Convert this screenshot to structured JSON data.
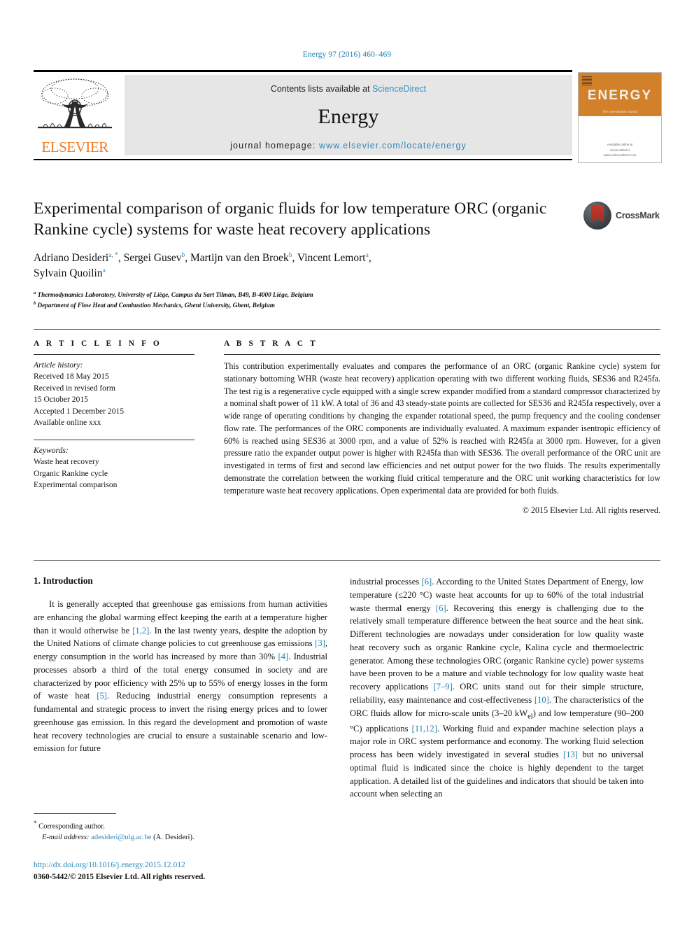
{
  "running_head": "Energy 97 (2016) 460–469",
  "banner": {
    "publisher_name": "ELSEVIER",
    "contents_prefix": "Contents lists available at ",
    "contents_link": "ScienceDirect",
    "journal_title": "Energy",
    "homepage_prefix": "journal homepage: ",
    "homepage_url": "www.elsevier.com/locate/energy",
    "cover_title": "ENERGY",
    "cover_subtitle": "The International Journal",
    "cover_footer": "Available online at\nScienceDirect\nwww.sciencedirect.com",
    "link_color": "#3a8fbf"
  },
  "article": {
    "title": "Experimental comparison of organic fluids for low temperature ORC (organic Rankine cycle) systems for waste heat recovery applications",
    "crossmark_label": "CrossMark",
    "authors_line_1_parts": [
      {
        "name": "Adriano Desideri",
        "sup": "a, *"
      },
      {
        "name": "Sergei Gusev",
        "sup": "b"
      },
      {
        "name": "Martijn van den Broek",
        "sup": "b"
      },
      {
        "name": "Vincent Lemort",
        "sup": "a"
      }
    ],
    "authors_line_2_parts": [
      {
        "name": "Sylvain Quoilin",
        "sup": "a"
      }
    ],
    "affiliations": [
      {
        "marker": "a",
        "text": "Thermodynamics Laboratory, University of Liège, Campus du Sart Tilman, B49, B-4000 Liège, Belgium"
      },
      {
        "marker": "b",
        "text": "Department of Flow Heat and Combustion Mechanics, Ghent University, Ghent, Belgium"
      }
    ]
  },
  "info": {
    "heading": "A R T I C L E  I N F O",
    "history_label": "Article history:",
    "history": [
      "Received 18 May 2015",
      "Received in revised form",
      "15 October 2015",
      "Accepted 1 December 2015",
      "Available online xxx"
    ],
    "keywords_label": "Keywords:",
    "keywords": [
      "Waste heat recovery",
      "Organic Rankine cycle",
      "Experimental comparison"
    ]
  },
  "abstract": {
    "heading": "A B S T R A C T",
    "text": "This contribution experimentally evaluates and compares the performance of an ORC (organic Rankine cycle) system for stationary bottoming WHR (waste heat recovery) application operating with two different working fluids, SES36 and R245fa. The test rig is a regenerative cycle equipped with a single screw expander modified from a standard compressor characterized by a nominal shaft power of 11 kW. A total of 36 and 43 steady-state points are collected for SES36 and R245fa respectively, over a wide range of operating conditions by changing the expander rotational speed, the pump frequency and the cooling condenser flow rate. The performances of the ORC components are individually evaluated. A maximum expander isentropic efficiency of 60% is reached using SES36 at 3000 rpm, and a value of 52% is reached with R245fa at 3000 rpm. However, for a given pressure ratio the expander output power is higher with R245fa than with SES36. The overall performance of the ORC unit are investigated in terms of first and second law efficiencies and net output power for the two fluids. The results experimentally demonstrate the correlation between the working fluid critical temperature and the ORC unit working characteristics for low temperature waste heat recovery applications. Open experimental data are provided for both fluids.",
    "copyright": "© 2015 Elsevier Ltd. All rights reserved."
  },
  "body": {
    "section_number_title": "1. Introduction",
    "left_paragraphs": [
      "It is generally accepted that greenhouse gas emissions from human activities are enhancing the global warming effect keeping the earth at a temperature higher than it would otherwise be [1,2]. In the last twenty years, despite the adoption by the United Nations of climate change policies to cut greenhouse gas emissions [3], energy consumption in the world has increased by more than 30% [4]. Industrial processes absorb a third of the total energy consumed in society and are characterized by poor efficiency with 25% up to 55% of energy losses in the form of waste heat [5]. Reducing industrial energy consumption represents a fundamental and strategic process to invert the rising energy prices and to lower greenhouse gas emission. In this regard the development and promotion of waste heat recovery technologies are crucial to ensure a sustainable scenario and low-emission for future"
    ],
    "right_paragraphs": [
      "industrial processes [6]. According to the United States Department of Energy, low temperature (≤220 °C) waste heat accounts for up to 60% of the total industrial waste thermal energy [6]. Recovering this energy is challenging due to the relatively small temperature difference between the heat source and the heat sink. Different technologies are nowadays under consideration for low quality waste heat recovery such as organic Rankine cycle, Kalina cycle and thermoelectric generator. Among these technologies ORC (organic Rankine cycle) power systems have been proven to be a mature and viable technology for low quality waste heat recovery applications [7–9]. ORC units stand out for their simple structure, reliability, easy maintenance and cost-effectiveness [10]. The characteristics of the ORC fluids allow for micro-scale units (3–20 kWel) and low temperature (90–200 °C) applications [11,12]. Working fluid and expander machine selection plays a major role in ORC system performance and economy. The working fluid selection process has been widely investigated in several studies [13] but no universal optimal fluid is indicated since the choice is highly dependent to the target application. A detailed list of the guidelines and indicators that should be taken into account when selecting an"
    ]
  },
  "footnote": {
    "corresponding_marker": "*",
    "corresponding_text": "Corresponding author.",
    "email_label": "E-mail address:",
    "email": "adesideri@ulg.ac.be",
    "email_owner": "(A. Desideri).",
    "doi": "http://dx.doi.org/10.1016/j.energy.2015.12.012",
    "issn": "0360-5442/© 2015 Elsevier Ltd. All rights reserved."
  }
}
